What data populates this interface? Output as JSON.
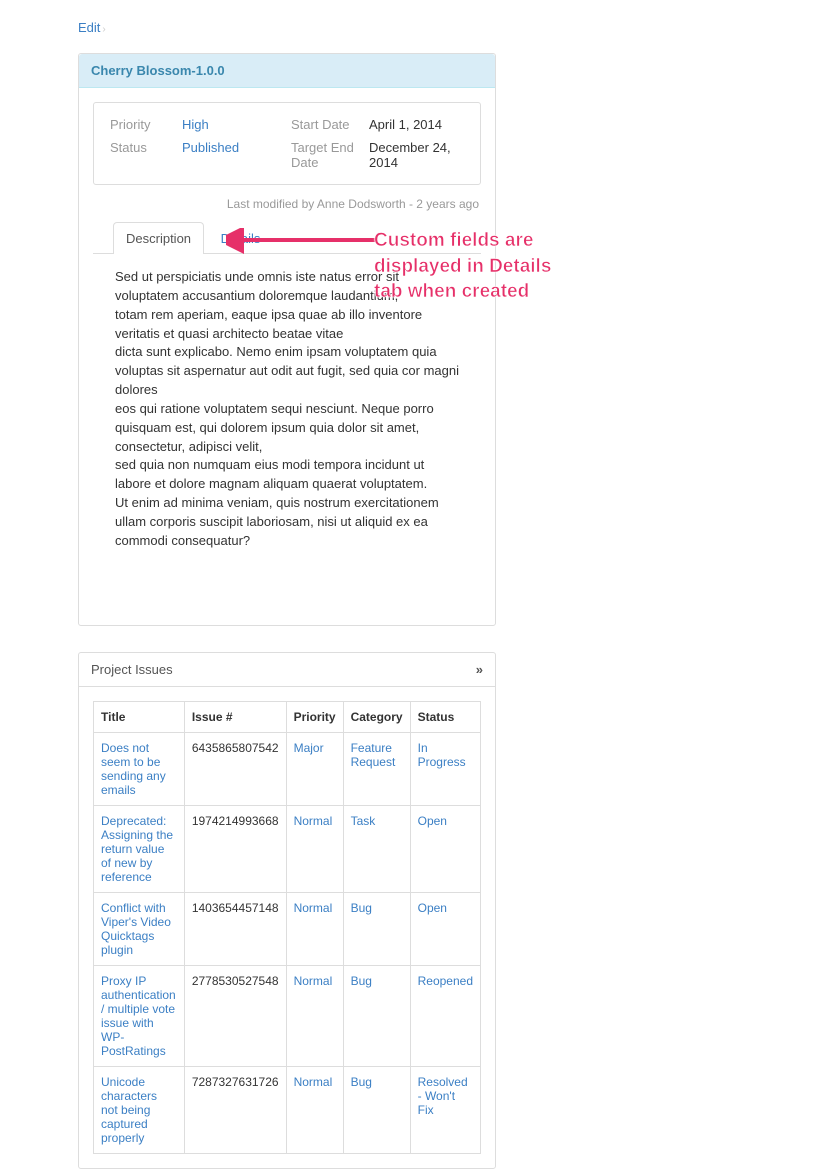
{
  "breadcrumb": {
    "edit": "Edit"
  },
  "release": {
    "title": "Cherry Blossom-1.0.0",
    "fields": {
      "priority_label": "Priority",
      "priority_value": "High",
      "status_label": "Status",
      "status_value": "Published",
      "start_date_label": "Start Date",
      "start_date_value": "April 1, 2014",
      "target_end_label": "Target End Date",
      "target_end_value": "December 24, 2014"
    },
    "modified": "Last modified by Anne Dodsworth - 2 years ago"
  },
  "tabs": {
    "description": "Description",
    "details": "Details"
  },
  "description": {
    "l1": "Sed ut perspiciatis unde omnis iste natus error sit voluptatem accusantium doloremque laudantium,",
    "l2": "totam rem aperiam, eaque ipsa quae ab illo inventore veritatis et quasi architecto beatae vitae",
    "l3": "dicta sunt explicabo. Nemo enim ipsam voluptatem quia voluptas sit aspernatur aut odit aut fugit, sed quia cor magni dolores",
    "l4": "eos qui ratione voluptatem sequi nesciunt. Neque porro quisquam est, qui dolorem ipsum quia dolor sit amet, consectetur, adipisci velit,",
    "l5": "sed quia non numquam eius modi tempora incidunt ut labore et dolore magnam aliquam quaerat voluptatem.",
    "l6": "Ut enim ad minima veniam, quis nostrum exercitationem ullam corporis suscipit laboriosam, nisi ut aliquid ex ea commodi consequatur?"
  },
  "annotation": {
    "l1": "Custom fields are",
    "l2": "displayed in Details",
    "l3": "tab when created"
  },
  "issues": {
    "header": "Project Issues",
    "columns": {
      "title": "Title",
      "issue": "Issue #",
      "priority": "Priority",
      "category": "Category",
      "status": "Status"
    },
    "rows": [
      {
        "title": "Does not seem to be sending any emails",
        "issue": "6435865807542",
        "priority": "Major",
        "category": "Feature Request",
        "status": "In Progress"
      },
      {
        "title": "Deprecated: Assigning the return value of new by reference",
        "issue": "1974214993668",
        "priority": "Normal",
        "category": "Task",
        "status": "Open"
      },
      {
        "title": "Conflict with Viper's Video Quicktags plugin",
        "issue": "1403654457148",
        "priority": "Normal",
        "category": "Bug",
        "status": "Open"
      },
      {
        "title": "Proxy IP authentication / multiple vote issue with WP-PostRatings",
        "issue": "2778530527548",
        "priority": "Normal",
        "category": "Bug",
        "status": "Reopened"
      },
      {
        "title": "Unicode characters not being captured properly",
        "issue": "7287327631726",
        "priority": "Normal",
        "category": "Bug",
        "status": "Resolved - Won't Fix"
      }
    ]
  }
}
